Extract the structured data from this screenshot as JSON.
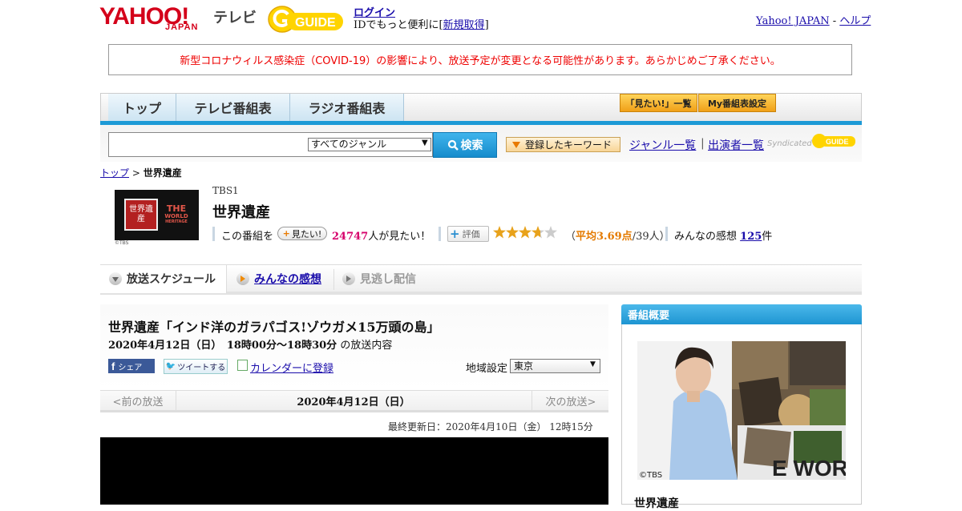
{
  "header": {
    "yahoo_logo": "YAHOO!",
    "japan_logo": "JAPAN",
    "tv_label": "テレビ",
    "gguide_logo": "GUIDE",
    "login": "ログイン",
    "login_prefix": "IDでもっと便利に[",
    "signup": "新規取得",
    "login_suffix": "]",
    "yahoo_japan_link": "Yahoo! JAPAN",
    "separator": "-",
    "help_link": "ヘルプ"
  },
  "notice": "新型コロナウィルス感染症（COVID-19）の影響により、放送予定が変更となる可能性があります。あらかじめご了承ください。",
  "nav": {
    "tabs": [
      "トップ",
      "テレビ番組表",
      "ラジオ番組表"
    ],
    "want_list": "「見たい!」一覧",
    "my_settings": "My番組表設定"
  },
  "search": {
    "genre_selected": "すべてのジャンル",
    "button": "検索",
    "keyword_button": "登録したキーワード",
    "genre_list": "ジャンル一覧",
    "separator": "|",
    "performer_list": "出演者一覧",
    "syndicated": "Syndicated"
  },
  "breadcrumb": {
    "top": "トップ",
    "sep": ">",
    "current": "世界遺産"
  },
  "program": {
    "thumb_jp": "世界遺産",
    "thumb_en": [
      "THE",
      "WORLD",
      "HERITAGE"
    ],
    "thumb_copy": "©TBS",
    "channel": "TBS1",
    "title": "世界遺産",
    "want_prefix": "この番組を",
    "want_button": "見たい!",
    "want_count": "24747",
    "want_suffix": "人が見たい！",
    "eval_button": "評価",
    "rating": 3.69,
    "avg_prefix": "（",
    "avg_value": "平均3.69点",
    "avg_suffix": "/39人）",
    "review_prefix": "みんなの感想",
    "review_count": "125",
    "review_suffix": "件"
  },
  "tabs": {
    "schedule": "放送スケジュール",
    "reviews": "みんなの感想",
    "missed": "見逃し配信"
  },
  "episode": {
    "title": "世界遺産「インド洋のガラパゴス!ゾウガメ15万頭の島」",
    "datetime": "2020年4月12日（日）　18時00分～18時30分",
    "datetime_suffix": "の放送内容",
    "share": "シェア",
    "tweet": "ツイートする",
    "calendar": "カレンダーに登録",
    "region_label": "地域設定",
    "region_value": "東京",
    "prev": "<前の放送",
    "current_date": "2020年4月12日（日）",
    "next": "次の放送>",
    "updated": "最終更新日：2020年4月10日（金）  12時15分"
  },
  "sidebar": {
    "heading": "番組概要",
    "image_copy": "©TBS",
    "image_text": "E WORL",
    "title": "世界遺産"
  }
}
